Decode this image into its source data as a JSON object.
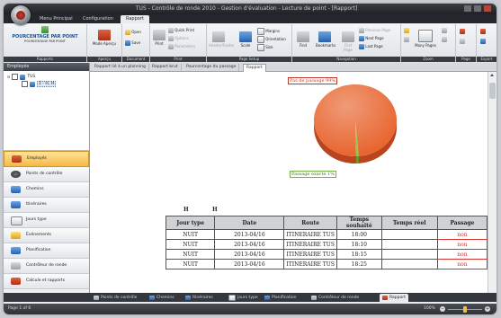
{
  "window": {
    "title": "TUS - Contrôle de ronde 2010 - Gestion d'évaluation - Lecture de point - [Rapport]"
  },
  "menu": {
    "tabs": [
      {
        "label": "Menu Principal"
      },
      {
        "label": "Configuration"
      },
      {
        "label": "Rapport"
      }
    ]
  },
  "ribbon": {
    "report_group": {
      "name_line1": "POURCENTAGE PAR POINT",
      "name_line2": "POURCENTAGE PAR POINT",
      "label": "Rapports"
    },
    "preview": {
      "mode_label": "Mode Aperçu",
      "label": "Aperçu"
    },
    "document": {
      "open": "Open",
      "save": "Save",
      "label": "Document"
    },
    "print": {
      "print": "Print",
      "quick_print": "Quick Print",
      "options": "Options",
      "parameters": "Parameters",
      "label": "Print"
    },
    "page_setup": {
      "header_footer": "Header/Footer",
      "scale": "Scale",
      "margins": "Margins",
      "orientation": "Orientation",
      "size": "Size",
      "label": "Page Setup"
    },
    "navigation": {
      "find": "Find",
      "bookmarks": "Bookmarks",
      "first_page": "First Page",
      "previous_page": "Previous Page",
      "next_page": "Next Page",
      "last_page": "Last Page",
      "label": "Navigation"
    },
    "zoom": {
      "many_pages": "Many Pages",
      "label": "Zoom"
    },
    "page_bg": {
      "label": "Page"
    },
    "export": {
      "label": "Export"
    }
  },
  "left_panel": {
    "header": "Employés",
    "tree": {
      "root": "TUS",
      "child": "1 - H, H"
    },
    "nav": [
      {
        "label": "Employés",
        "icon": "employees-icon"
      },
      {
        "label": "Points de contrôle",
        "icon": "checkpoint-icon"
      },
      {
        "label": "Chemins",
        "icon": "paths-icon"
      },
      {
        "label": "Itinéraires",
        "icon": "itinerary-icon"
      },
      {
        "label": "Jours type",
        "icon": "calendar-icon"
      },
      {
        "label": "Événements",
        "icon": "events-icon"
      },
      {
        "label": "Planification",
        "icon": "planning-icon"
      },
      {
        "label": "Contrôleur de ronde",
        "icon": "controller-icon"
      },
      {
        "label": "Calcule et rapports",
        "icon": "reports-icon"
      }
    ]
  },
  "doc_tabs": [
    {
      "label": "Rapport lié à un planning"
    },
    {
      "label": "Rapport brut"
    },
    {
      "label": "Pourcentage du passage"
    },
    {
      "label": "Rapport"
    }
  ],
  "report": {
    "pie_label_top": "Pas de passage 99%",
    "pie_label_bottom": "Passage exacte 1%",
    "header_left": "H",
    "header_right": "H",
    "columns": [
      "Jour type",
      "Date",
      "Route",
      "Temps souhaité",
      "Temps réel",
      "Passage"
    ],
    "rows": [
      [
        "NUIT",
        "2013-04/16",
        "ITINERAIRE TUS",
        "18:00",
        "",
        "non"
      ],
      [
        "NUIT",
        "2013-04/16",
        "ITINERAIRE TUS",
        "18:10",
        "",
        "non"
      ],
      [
        "NUIT",
        "2013-04/16",
        "ITINERAIRE TUS",
        "18:15",
        "",
        "non"
      ],
      [
        "NUIT",
        "2013-04/16",
        "ITINERAIRE TUS",
        "18:25",
        "",
        "non"
      ]
    ]
  },
  "chart_data": {
    "type": "pie",
    "title": "",
    "series": [
      {
        "name": "Pas de passage",
        "values": [
          99
        ]
      },
      {
        "name": "Passage exacte",
        "values": [
          1
        ]
      }
    ],
    "categories": [
      "Pas de passage",
      "Passage exacte"
    ],
    "values": [
      99,
      1
    ],
    "colors": [
      "#e8652f",
      "#8fc63f"
    ]
  },
  "bottom_tabs": [
    {
      "label": "Points de contrôle"
    },
    {
      "label": "Chemins"
    },
    {
      "label": "Itinéraires"
    },
    {
      "label": "Jours type"
    },
    {
      "label": "Planification"
    },
    {
      "label": "Contrôleur de ronde"
    },
    {
      "label": "Rapport"
    }
  ],
  "status": {
    "page": "Page 1 of 6",
    "zoom": "100%",
    "zoom_level": 0.5
  },
  "colors": {
    "accent": "#f6b846",
    "pie_main": "#e8652f",
    "pie_minor": "#8fc63f",
    "pass_no": "#d0342c"
  }
}
